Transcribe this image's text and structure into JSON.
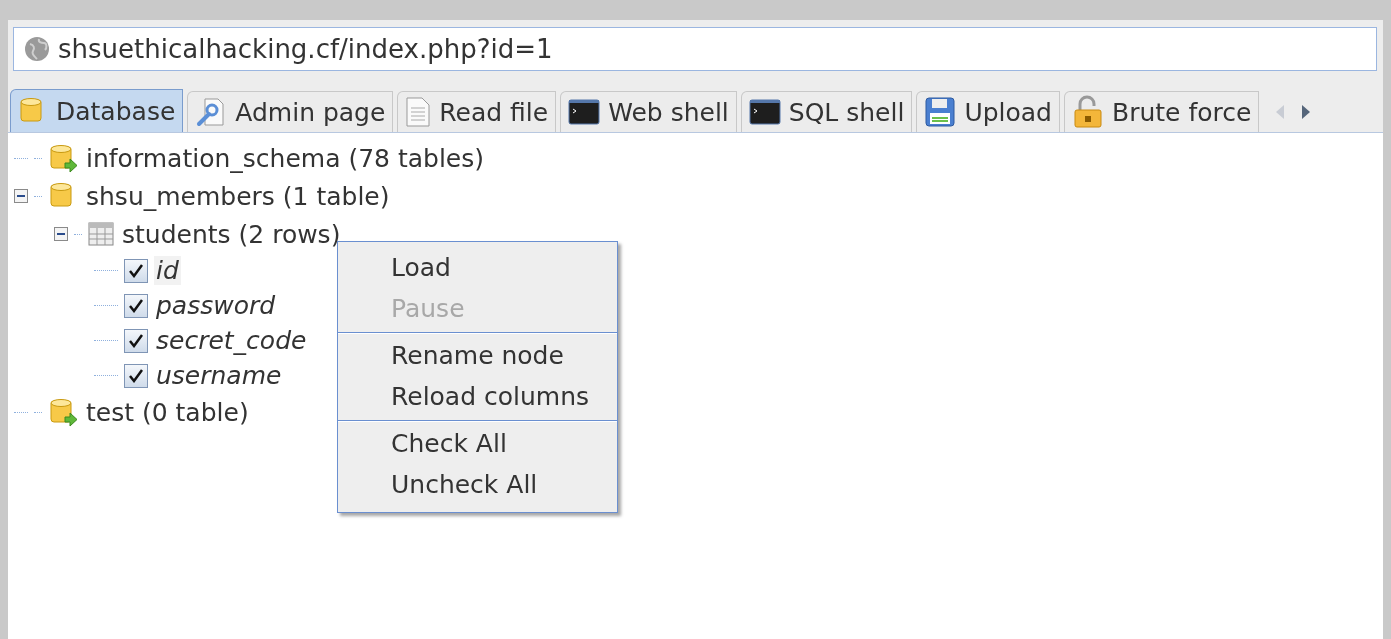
{
  "address_bar": {
    "value": "shsuethicalhacking.cf/index.php?id=1"
  },
  "tabs": [
    {
      "label": "Database",
      "kind": "database",
      "selected": true
    },
    {
      "label": "Admin page",
      "kind": "admin",
      "selected": false
    },
    {
      "label": "Read file",
      "kind": "file",
      "selected": false
    },
    {
      "label": "Web shell",
      "kind": "terminal",
      "selected": false
    },
    {
      "label": "SQL shell",
      "kind": "terminal",
      "selected": false
    },
    {
      "label": "Upload",
      "kind": "upload",
      "selected": false
    },
    {
      "label": "Brute force",
      "kind": "lock",
      "selected": false
    }
  ],
  "tree": [
    {
      "label": "information_schema (78 tables)",
      "kind": "database",
      "expanded": false
    },
    {
      "label": "shsu_members (1 table)",
      "kind": "database",
      "expanded": true,
      "children": [
        {
          "label": "students (2 rows)",
          "kind": "table",
          "expanded": true,
          "children": [
            {
              "label": "id",
              "kind": "column",
              "checked": true,
              "selected": true
            },
            {
              "label": "password",
              "kind": "column",
              "checked": true,
              "selected": false
            },
            {
              "label": "secret_code",
              "kind": "column",
              "checked": true,
              "selected": false
            },
            {
              "label": "username",
              "kind": "column",
              "checked": true,
              "selected": false
            }
          ]
        }
      ]
    },
    {
      "label": "test (0 table)",
      "kind": "database",
      "expanded": false
    }
  ],
  "context_menu": [
    {
      "kind": "item",
      "label": "Load",
      "disabled": false
    },
    {
      "kind": "item",
      "label": "Pause",
      "disabled": true
    },
    {
      "kind": "separator"
    },
    {
      "kind": "item",
      "label": "Rename node",
      "disabled": false
    },
    {
      "kind": "item",
      "label": "Reload columns",
      "disabled": false
    },
    {
      "kind": "separator"
    },
    {
      "kind": "item",
      "label": "Check All",
      "disabled": false
    },
    {
      "kind": "item",
      "label": "Uncheck All",
      "disabled": false
    }
  ]
}
